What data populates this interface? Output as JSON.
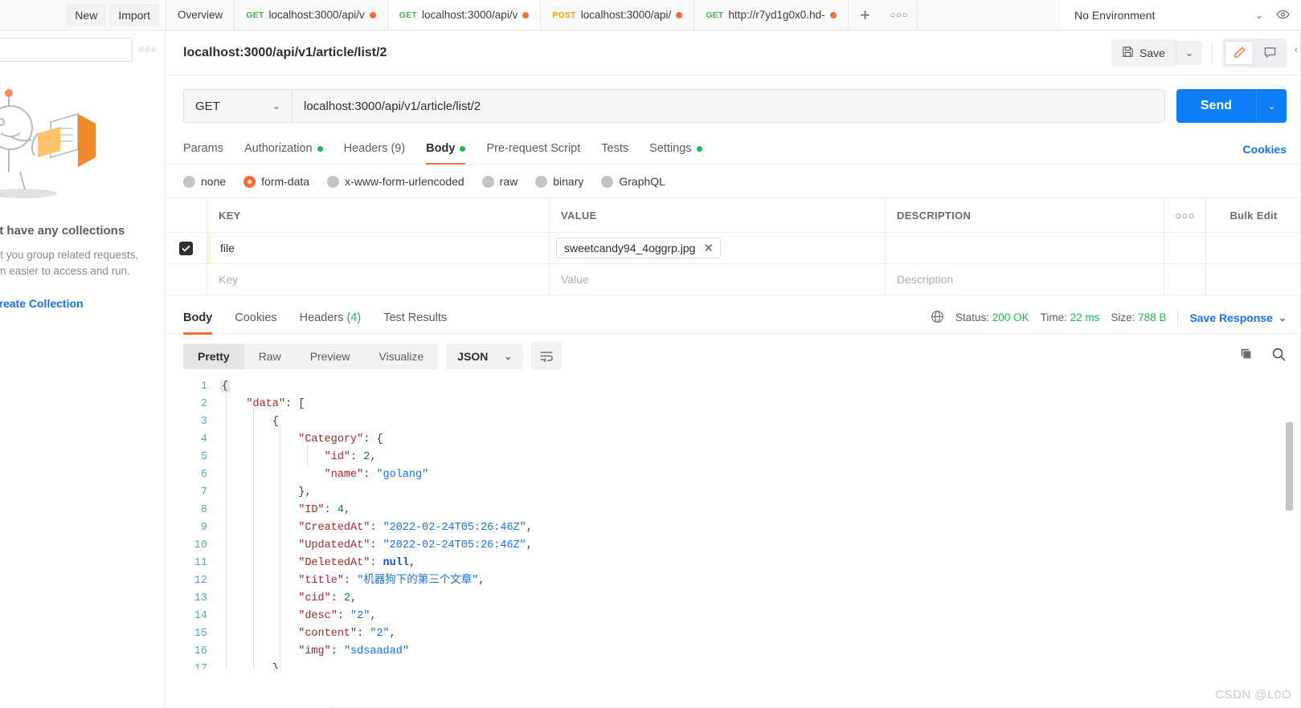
{
  "topbar": {
    "new_label": "New",
    "import_label": "Import",
    "tabs": [
      {
        "method": "",
        "label": "Overview",
        "dirty": false,
        "active": false
      },
      {
        "method": "GET",
        "label": "localhost:3000/api/v",
        "dirty": true,
        "active": false
      },
      {
        "method": "GET",
        "label": "localhost:3000/api/v",
        "dirty": true,
        "active": true
      },
      {
        "method": "POST",
        "label": "localhost:3000/api/",
        "dirty": true,
        "active": false
      },
      {
        "method": "GET",
        "label": "http://r7yd1g0x0.hd-",
        "dirty": true,
        "active": false
      }
    ],
    "add_tab_icon": "plus-icon",
    "tab_options_icon": "ellipsis-icon",
    "environment": "No Environment",
    "environment_caret": "chevron-down-icon",
    "eye_icon": "eye-icon"
  },
  "sidebar": {
    "search_placeholder": "",
    "more_icon": "ellipsis-icon",
    "empty_title": "You don't have any collections",
    "empty_desc": "Collections let you group related requests, making them easier to access and run.",
    "create_link": "Create Collection"
  },
  "request": {
    "title": "localhost:3000/api/v1/article/list/2",
    "save_label": "Save",
    "save_icon": "floppy-disk-icon",
    "save_caret_icon": "chevron-down-icon",
    "edit_icon": "pencil-icon",
    "comment_icon": "comment-icon",
    "method": "GET",
    "url": "localhost:3000/api/v1/article/list/2",
    "send_label": "Send",
    "send_caret_icon": "chevron-down-icon",
    "tabs": [
      {
        "label": "Params",
        "badge": "",
        "indicator": false,
        "active": false
      },
      {
        "label": "Authorization",
        "badge": "",
        "indicator": true,
        "active": false
      },
      {
        "label": "Headers",
        "badge": "(9)",
        "indicator": false,
        "active": false
      },
      {
        "label": "Body",
        "badge": "",
        "indicator": true,
        "active": true
      },
      {
        "label": "Pre-request Script",
        "badge": "",
        "indicator": false,
        "active": false
      },
      {
        "label": "Tests",
        "badge": "",
        "indicator": false,
        "active": false
      },
      {
        "label": "Settings",
        "badge": "",
        "indicator": true,
        "active": false
      }
    ],
    "cookies_link": "Cookies",
    "body_types": [
      {
        "label": "none",
        "selected": false
      },
      {
        "label": "form-data",
        "selected": true
      },
      {
        "label": "x-www-form-urlencoded",
        "selected": false
      },
      {
        "label": "raw",
        "selected": false
      },
      {
        "label": "binary",
        "selected": false
      },
      {
        "label": "GraphQL",
        "selected": false
      }
    ],
    "table": {
      "headers": {
        "key": "KEY",
        "value": "VALUE",
        "description": "DESCRIPTION"
      },
      "more_icon": "ellipsis-icon",
      "bulk_edit": "Bulk Edit",
      "rows": [
        {
          "checked": true,
          "key": "file",
          "value": "sweetcandy94_4oggrp.jpg",
          "value_is_file": true,
          "remove_icon": "close-icon",
          "description": ""
        }
      ],
      "placeholder_row": {
        "key": "Key",
        "value": "Value",
        "description": "Description"
      }
    }
  },
  "response": {
    "tabs": [
      {
        "label": "Body",
        "count": "",
        "active": true
      },
      {
        "label": "Cookies",
        "count": "",
        "active": false
      },
      {
        "label": "Headers",
        "count": "(4)",
        "active": false
      },
      {
        "label": "Test Results",
        "count": "",
        "active": false
      }
    ],
    "globe_icon": "globe-icon",
    "status_label": "Status:",
    "status_value": "200 OK",
    "time_label": "Time:",
    "time_value": "22 ms",
    "size_label": "Size:",
    "size_value": "788 B",
    "save_response": "Save Response",
    "save_response_caret": "chevron-down-icon",
    "view_modes": [
      {
        "label": "Pretty",
        "active": true
      },
      {
        "label": "Raw",
        "active": false
      },
      {
        "label": "Preview",
        "active": false
      },
      {
        "label": "Visualize",
        "active": false
      }
    ],
    "format": "JSON",
    "format_caret": "chevron-down-icon",
    "wrap_icon": "word-wrap-icon",
    "copy_icon": "copy-icon",
    "search_icon": "search-icon",
    "body_lines": [
      {
        "n": 1,
        "tokens": [
          {
            "t": "fold",
            "v": "{"
          }
        ]
      },
      {
        "n": 2,
        "tokens": [
          {
            "t": "p",
            "v": "    "
          },
          {
            "t": "k",
            "v": "\"data\""
          },
          {
            "t": "p",
            "v": ": "
          },
          {
            "t": "br",
            "v": "["
          }
        ]
      },
      {
        "n": 3,
        "tokens": [
          {
            "t": "p",
            "v": "        "
          },
          {
            "t": "br",
            "v": "{"
          }
        ]
      },
      {
        "n": 4,
        "tokens": [
          {
            "t": "p",
            "v": "            "
          },
          {
            "t": "k",
            "v": "\"Category\""
          },
          {
            "t": "p",
            "v": ": "
          },
          {
            "t": "br",
            "v": "{"
          }
        ]
      },
      {
        "n": 5,
        "tokens": [
          {
            "t": "p",
            "v": "                "
          },
          {
            "t": "k",
            "v": "\"id\""
          },
          {
            "t": "p",
            "v": ": "
          },
          {
            "t": "n",
            "v": "2"
          },
          {
            "t": "p",
            "v": ","
          }
        ]
      },
      {
        "n": 6,
        "tokens": [
          {
            "t": "p",
            "v": "                "
          },
          {
            "t": "k",
            "v": "\"name\""
          },
          {
            "t": "p",
            "v": ": "
          },
          {
            "t": "s",
            "v": "\"golang\""
          }
        ]
      },
      {
        "n": 7,
        "tokens": [
          {
            "t": "p",
            "v": "            "
          },
          {
            "t": "br",
            "v": "}"
          },
          {
            "t": "p",
            "v": ","
          }
        ]
      },
      {
        "n": 8,
        "tokens": [
          {
            "t": "p",
            "v": "            "
          },
          {
            "t": "k",
            "v": "\"ID\""
          },
          {
            "t": "p",
            "v": ": "
          },
          {
            "t": "n",
            "v": "4"
          },
          {
            "t": "p",
            "v": ","
          }
        ]
      },
      {
        "n": 9,
        "tokens": [
          {
            "t": "p",
            "v": "            "
          },
          {
            "t": "k",
            "v": "\"CreatedAt\""
          },
          {
            "t": "p",
            "v": ": "
          },
          {
            "t": "s",
            "v": "\"2022-02-24T05:26:46Z\""
          },
          {
            "t": "p",
            "v": ","
          }
        ]
      },
      {
        "n": 10,
        "tokens": [
          {
            "t": "p",
            "v": "            "
          },
          {
            "t": "k",
            "v": "\"UpdatedAt\""
          },
          {
            "t": "p",
            "v": ": "
          },
          {
            "t": "s",
            "v": "\"2022-02-24T05:26:46Z\""
          },
          {
            "t": "p",
            "v": ","
          }
        ]
      },
      {
        "n": 11,
        "tokens": [
          {
            "t": "p",
            "v": "            "
          },
          {
            "t": "k",
            "v": "\"DeletedAt\""
          },
          {
            "t": "p",
            "v": ": "
          },
          {
            "t": "nul",
            "v": "null"
          },
          {
            "t": "p",
            "v": ","
          }
        ]
      },
      {
        "n": 12,
        "tokens": [
          {
            "t": "p",
            "v": "            "
          },
          {
            "t": "k",
            "v": "\"title\""
          },
          {
            "t": "p",
            "v": ": "
          },
          {
            "t": "s",
            "v": "\"机器狗下的第三个文章\""
          },
          {
            "t": "p",
            "v": ","
          }
        ]
      },
      {
        "n": 13,
        "tokens": [
          {
            "t": "p",
            "v": "            "
          },
          {
            "t": "k",
            "v": "\"cid\""
          },
          {
            "t": "p",
            "v": ": "
          },
          {
            "t": "n",
            "v": "2"
          },
          {
            "t": "p",
            "v": ","
          }
        ]
      },
      {
        "n": 14,
        "tokens": [
          {
            "t": "p",
            "v": "            "
          },
          {
            "t": "k",
            "v": "\"desc\""
          },
          {
            "t": "p",
            "v": ": "
          },
          {
            "t": "s",
            "v": "\"2\""
          },
          {
            "t": "p",
            "v": ","
          }
        ]
      },
      {
        "n": 15,
        "tokens": [
          {
            "t": "p",
            "v": "            "
          },
          {
            "t": "k",
            "v": "\"content\""
          },
          {
            "t": "p",
            "v": ": "
          },
          {
            "t": "s",
            "v": "\"2\""
          },
          {
            "t": "p",
            "v": ","
          }
        ]
      },
      {
        "n": 16,
        "tokens": [
          {
            "t": "p",
            "v": "            "
          },
          {
            "t": "k",
            "v": "\"img\""
          },
          {
            "t": "p",
            "v": ": "
          },
          {
            "t": "s",
            "v": "\"sdsaadad\""
          }
        ]
      },
      {
        "n": 17,
        "tokens": [
          {
            "t": "p",
            "v": "        "
          },
          {
            "t": "br",
            "v": "}"
          }
        ]
      }
    ]
  },
  "watermark": "CSDN @L0O"
}
